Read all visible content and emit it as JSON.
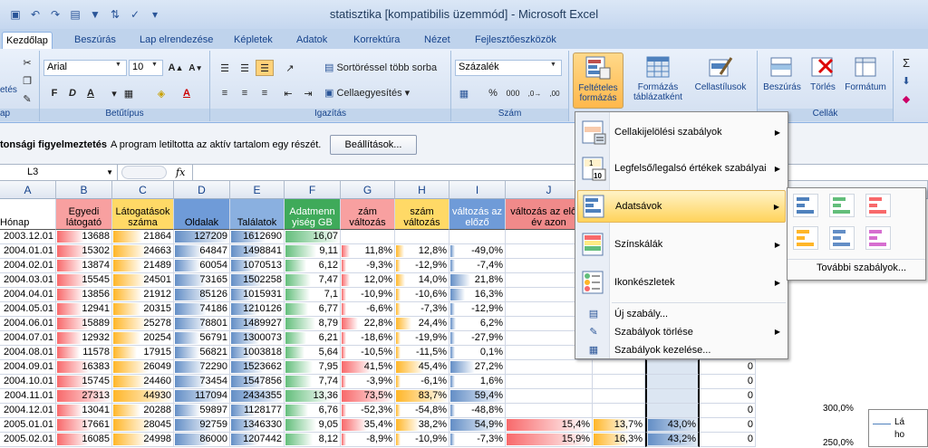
{
  "window": {
    "title": "statisztika  [kompatibilis üzemmód]  -  Microsoft Excel"
  },
  "tabs": [
    "Kezdőlap",
    "Beszúrás",
    "Lap elrendezése",
    "Képletek",
    "Adatok",
    "Korrektúra",
    "Nézet",
    "Fejlesztőeszközök"
  ],
  "ribbon": {
    "clipboard": {
      "label": "ap",
      "paste_fragment": "etés"
    },
    "font": {
      "label": "Betűtípus",
      "font_name": "Arial",
      "font_size": "10",
      "bold": "F",
      "italic": "D",
      "underline": "A"
    },
    "alignment": {
      "label": "Igazítás",
      "wrap": "Sortöréssel több sorba",
      "merge": "Cellaegyesítés"
    },
    "number": {
      "label": "Szám",
      "format": "Százalék",
      "percent": "%",
      "thousands": "000"
    },
    "styles": {
      "cond_format": "Feltételes formázás",
      "format_table": "Formázás táblázatként",
      "cell_styles": "Cellastílusok"
    },
    "cells": {
      "label": "Cellák",
      "insert": "Beszúrás",
      "delete": "Törlés",
      "format": "Formátum"
    },
    "editing": {
      "sum": "Σ"
    }
  },
  "security": {
    "title": "tonsági figyelmeztetés",
    "message": "A program letiltotta az aktív tartalom egy részét.",
    "button": "Beállítások..."
  },
  "formula_bar": {
    "name_box": "L3",
    "fx": "fx",
    "formula": ""
  },
  "columns": [
    "A",
    "B",
    "C",
    "D",
    "E",
    "F",
    "G",
    "H",
    "I",
    "J"
  ],
  "headers": {
    "A": "Hónap",
    "B": "Egyedi látogató",
    "C": "Látogatások száma",
    "D": "Oldalak",
    "E": "Találatok",
    "F": "Adatmenn yiség GB",
    "G": "zám változás",
    "H": "szám változás",
    "I": "változás az előző",
    "J": "változás az előző év azon"
  },
  "rows": [
    {
      "a": "2003.12.01",
      "b": "13688",
      "c": "21864",
      "d": "127209",
      "e": "1612690",
      "f": "16,07",
      "g": "",
      "h": "",
      "i": "",
      "j": ""
    },
    {
      "a": "2004.01.01",
      "b": "15302",
      "c": "24663",
      "d": "64847",
      "e": "1498841",
      "f": "9,11",
      "g": "11,8%",
      "h": "12,8%",
      "i": "-49,0%",
      "j": ""
    },
    {
      "a": "2004.02.01",
      "b": "13874",
      "c": "21489",
      "d": "60054",
      "e": "1070513",
      "f": "6,12",
      "g": "-9,3%",
      "h": "-12,9%",
      "i": "-7,4%",
      "j": ""
    },
    {
      "a": "2004.03.01",
      "b": "15545",
      "c": "24501",
      "d": "73165",
      "e": "1502258",
      "f": "7,47",
      "g": "12,0%",
      "h": "14,0%",
      "i": "21,8%",
      "j": ""
    },
    {
      "a": "2004.04.01",
      "b": "13856",
      "c": "21912",
      "d": "85126",
      "e": "1015931",
      "f": "7,1",
      "g": "-10,9%",
      "h": "-10,6%",
      "i": "16,3%",
      "j": ""
    },
    {
      "a": "2004.05.01",
      "b": "12941",
      "c": "20315",
      "d": "74186",
      "e": "1210126",
      "f": "6,77",
      "g": "-6,6%",
      "h": "-7,3%",
      "i": "-12,9%",
      "j": ""
    },
    {
      "a": "2004.06.01",
      "b": "15889",
      "c": "25278",
      "d": "78801",
      "e": "1489927",
      "f": "8,79",
      "g": "22,8%",
      "h": "24,4%",
      "i": "6,2%",
      "j": ""
    },
    {
      "a": "2004.07.01",
      "b": "12932",
      "c": "20254",
      "d": "56791",
      "e": "1300073",
      "f": "6,21",
      "g": "-18,6%",
      "h": "-19,9%",
      "i": "-27,9%",
      "j": ""
    },
    {
      "a": "2004.08.01",
      "b": "11578",
      "c": "17915",
      "d": "56821",
      "e": "1003818",
      "f": "5,64",
      "g": "-10,5%",
      "h": "-11,5%",
      "i": "0,1%",
      "j": ""
    },
    {
      "a": "2004.09.01",
      "b": "16383",
      "c": "26049",
      "d": "72290",
      "e": "1523662",
      "f": "7,95",
      "g": "41,5%",
      "h": "45,4%",
      "i": "27,2%",
      "j": ""
    },
    {
      "a": "2004.10.01",
      "b": "15745",
      "c": "24460",
      "d": "73454",
      "e": "1547856",
      "f": "7,74",
      "g": "-3,9%",
      "h": "-6,1%",
      "i": "1,6%",
      "j": ""
    },
    {
      "a": "2004.11.01",
      "b": "27313",
      "c": "44930",
      "d": "117094",
      "e": "2434355",
      "f": "13,36",
      "g": "73,5%",
      "h": "83,7%",
      "i": "59,4%",
      "j": ""
    },
    {
      "a": "2004.12.01",
      "b": "13041",
      "c": "20288",
      "d": "59897",
      "e": "1128177",
      "f": "6,76",
      "g": "-52,3%",
      "h": "-54,8%",
      "i": "-48,8%",
      "j": ""
    },
    {
      "a": "2005.01.01",
      "b": "17661",
      "c": "28045",
      "d": "92759",
      "e": "1346330",
      "f": "9,05",
      "g": "35,4%",
      "h": "38,2%",
      "i": "54,9%",
      "j": "15,4%"
    },
    {
      "a": "2005.02.01",
      "b": "16085",
      "c": "24998",
      "d": "86000",
      "e": "1207442",
      "f": "8,12",
      "g": "-8,9%",
      "h": "-10,9%",
      "i": "-7,3%",
      "j": "15,9%"
    }
  ],
  "extra_cols": {
    "k": [
      "",
      "",
      "",
      "",
      "",
      "",
      "",
      "",
      "",
      "",
      "",
      "",
      "",
      "13,7%",
      "16,3%"
    ],
    "l": [
      "",
      "",
      "",
      "",
      "",
      "",
      "",
      "",
      "",
      "",
      "",
      "",
      "",
      "43,0%",
      "43,2%"
    ],
    "m": [
      "",
      "",
      "",
      "",
      "",
      "",
      "",
      "",
      "",
      "0",
      "0",
      "0",
      "0",
      "0",
      "0"
    ]
  },
  "cf_menu": {
    "items": [
      {
        "label": "Cellakijelölési szabályok",
        "icon": "highlight-rules-icon"
      },
      {
        "label": "Legfelső/legalsó értékek szabályai",
        "icon": "top-bottom-icon"
      },
      {
        "label": "Adatsávok",
        "icon": "databars-icon"
      },
      {
        "label": "Színskálák",
        "icon": "color-scales-icon"
      },
      {
        "label": "Ikonkészletek",
        "icon": "icon-sets-icon"
      }
    ],
    "small": [
      "Új szabály...",
      "Szabályok törlése",
      "Szabályok kezelése..."
    ]
  },
  "databar_submenu": {
    "more": "További szabályok...",
    "colors": [
      "#4f81bd",
      "#63be7b",
      "#f8696b",
      "#ffb628",
      "#638ec6",
      "#d66ed0"
    ]
  },
  "chart": {
    "tick1": "300,0%",
    "tick2": "250,0%",
    "legend_fragment": "Lá",
    "legend_fragment2": "ho"
  },
  "colors": {
    "blue": "#638ec6",
    "green": "#63be7b",
    "red": "#f8696b",
    "orange": "#ffb628"
  }
}
